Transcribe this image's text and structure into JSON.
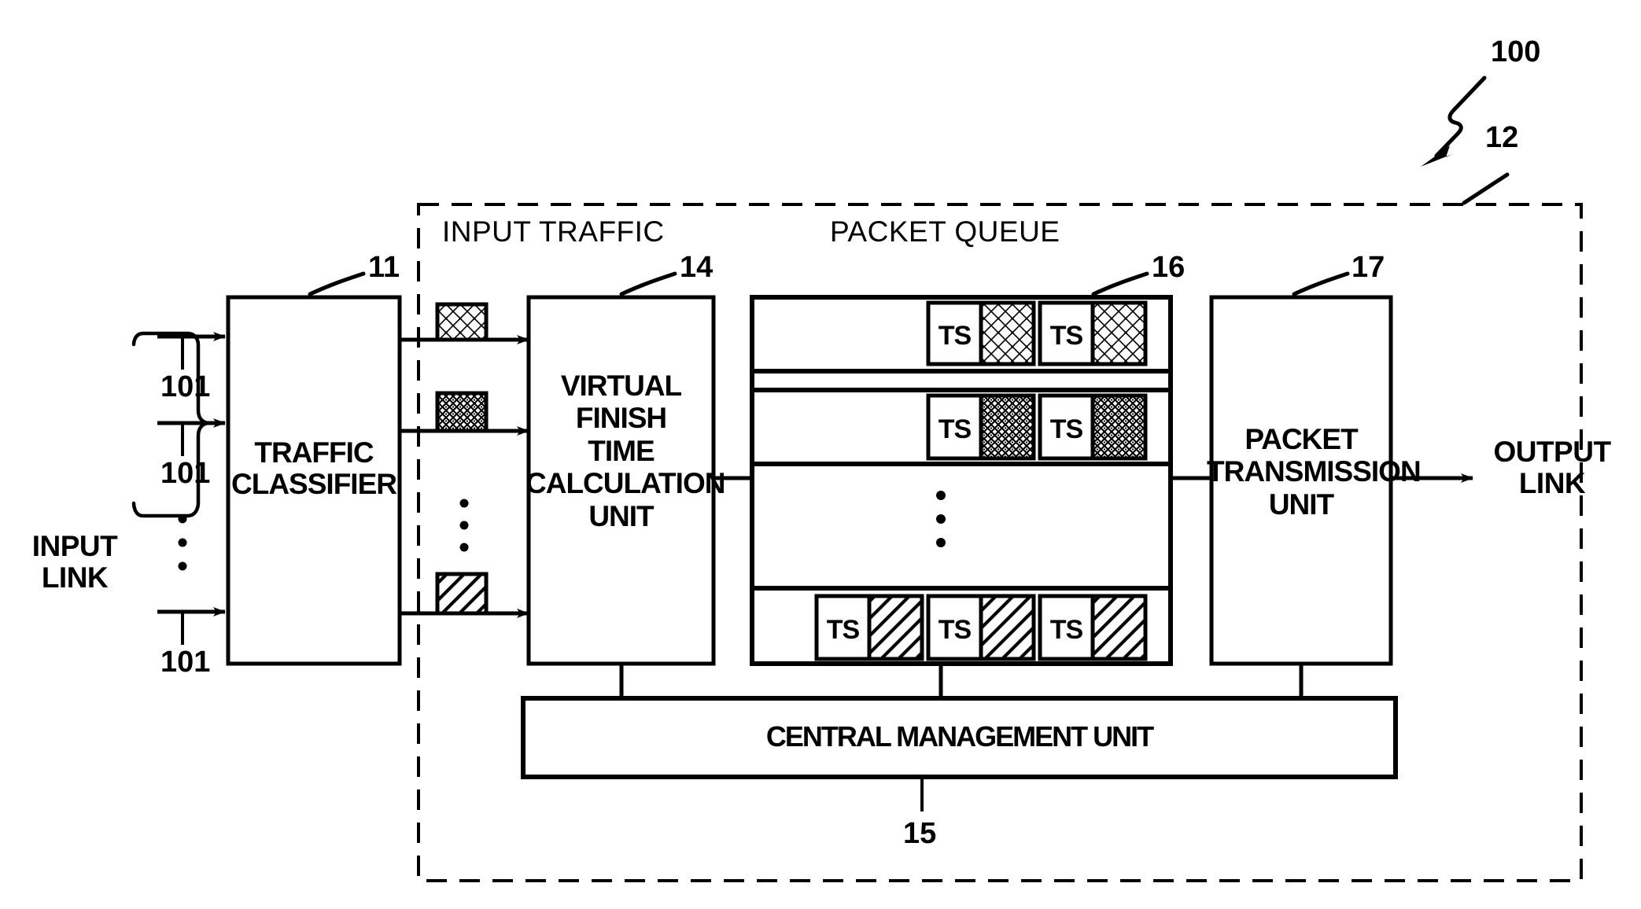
{
  "figure": {
    "top_ref": "100",
    "outer_block_ref": "12"
  },
  "sections": {
    "input_traffic_label": "INPUT TRAFFIC",
    "packet_queue_label": "PACKET QUEUE"
  },
  "links": {
    "input_link_label": "INPUT\nLINK",
    "output_link_label": "OUTPUT\nLINK",
    "input_link_refs": [
      "101",
      "101",
      "101"
    ],
    "vertical_ellipsis": "⋮"
  },
  "blocks": [
    {
      "id": "traffic-classifier",
      "label": "TRAFFIC\nCLASSIFIER",
      "ref": "11"
    },
    {
      "id": "virtual-finish-time-calculation-unit",
      "label": "VIRTUAL\nFINISH\nTIME\nCALCULATION\nUNIT",
      "ref": "14"
    },
    {
      "id": "packet-queue",
      "label": "PACKET QUEUE",
      "ref": "16"
    },
    {
      "id": "packet-transmission-unit",
      "label": "PACKET\nTRANSMISSION\nUNIT",
      "ref": "17"
    },
    {
      "id": "central-management-unit",
      "label": "CENTRAL MANAGEMENT UNIT",
      "ref": "15"
    }
  ],
  "queue_rows": [
    {
      "pattern": "light-crosshatch",
      "packets": [
        {
          "ts": "TS"
        },
        {
          "ts": "TS"
        }
      ]
    },
    {
      "pattern": "dense-stipple",
      "packets": [
        {
          "ts": "TS"
        },
        {
          "ts": "TS"
        }
      ]
    },
    {
      "pattern": "ellipsis",
      "packets": []
    },
    {
      "pattern": "diagonal-hatch",
      "packets": [
        {
          "ts": "TS"
        },
        {
          "ts": "TS"
        },
        {
          "ts": "TS"
        }
      ]
    }
  ],
  "input_packets": [
    {
      "pattern": "light-crosshatch"
    },
    {
      "pattern": "dense-stipple"
    },
    {
      "pattern": "diagonal-hatch"
    }
  ],
  "colors": {
    "ink": "#000000",
    "paper": "#ffffff"
  }
}
